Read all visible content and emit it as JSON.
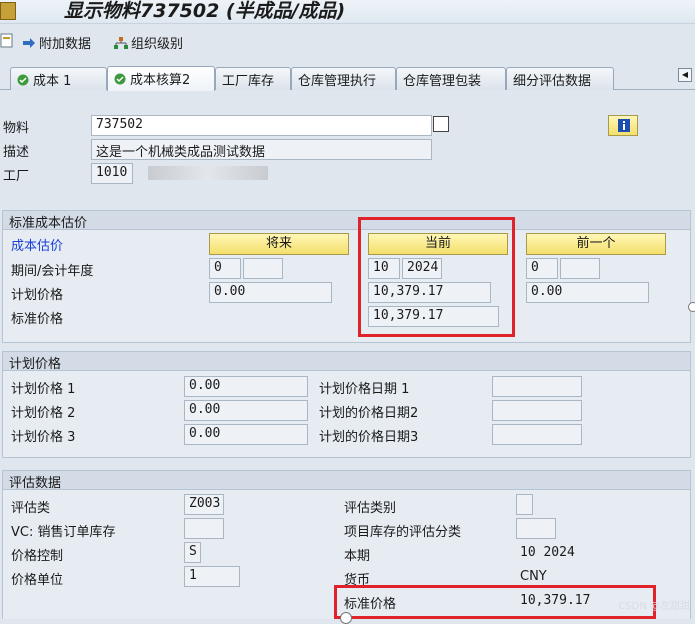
{
  "title": "显示物料737502 (半成品/成品)",
  "toolbar": {
    "attach_data": "附加数据",
    "org_levels": "组织级别"
  },
  "tabs": [
    {
      "label": "成本 1"
    },
    {
      "label": "成本核算2"
    },
    {
      "label": "工厂库存"
    },
    {
      "label": "仓库管理执行"
    },
    {
      "label": "仓库管理包装"
    },
    {
      "label": "细分评估数据"
    }
  ],
  "header": {
    "material_label": "物料",
    "material_value": "737502",
    "desc_label": "描述",
    "desc_value": "这是一个机械类成品测试数据",
    "plant_label": "工厂",
    "plant_value": "1010"
  },
  "std_cost_estimate": {
    "title": "标准成本估价",
    "cost_estimate_label": "成本估价",
    "future_button": "将来",
    "current_button": "当前",
    "previous_button": "前一个",
    "period_label": "期间/会计年度",
    "planned_price_label": "计划价格",
    "standard_price_label": "标准价格",
    "future": {
      "period": "0",
      "year": "",
      "planned_price": "0.00"
    },
    "current": {
      "period": "10",
      "year": "2024",
      "planned_price": "10,379.17",
      "standard_price": "10,379.17"
    },
    "previous": {
      "period": "0",
      "year": "",
      "planned_price": "0.00"
    }
  },
  "planned_prices": {
    "title": "计划价格",
    "rows": [
      {
        "price_label": "计划价格 1",
        "price_value": "0.00",
        "date_label": "计划价格日期 1",
        "date_value": ""
      },
      {
        "price_label": "计划价格 2",
        "price_value": "0.00",
        "date_label": "计划的价格日期2",
        "date_value": ""
      },
      {
        "price_label": "计划价格 3",
        "price_value": "0.00",
        "date_label": "计划的价格日期3",
        "date_value": ""
      }
    ]
  },
  "valuation": {
    "title": "评估数据",
    "valuation_class_label": "评估类",
    "valuation_class_value": "Z003",
    "vc_label": "VC: 销售订单库存",
    "vc_value": "",
    "price_control_label": "价格控制",
    "price_control_value": "S",
    "price_unit_label": "价格单位",
    "price_unit_value": "1",
    "valuation_cat_label": "评估类别",
    "valuation_cat_value": "",
    "proj_stock_label": "项目库存的评估分类",
    "proj_stock_value": "",
    "current_period_label": "本期",
    "current_period_value": "10 2024",
    "currency_label": "货币",
    "currency_value": "CNY",
    "standard_price_label": "标准价格",
    "standard_price_value": "10,379.17"
  },
  "watermark": "CSDN @左甜甜",
  "colors": {
    "highlight": "#e0232a",
    "accent_blue": "#1a3fd6"
  }
}
